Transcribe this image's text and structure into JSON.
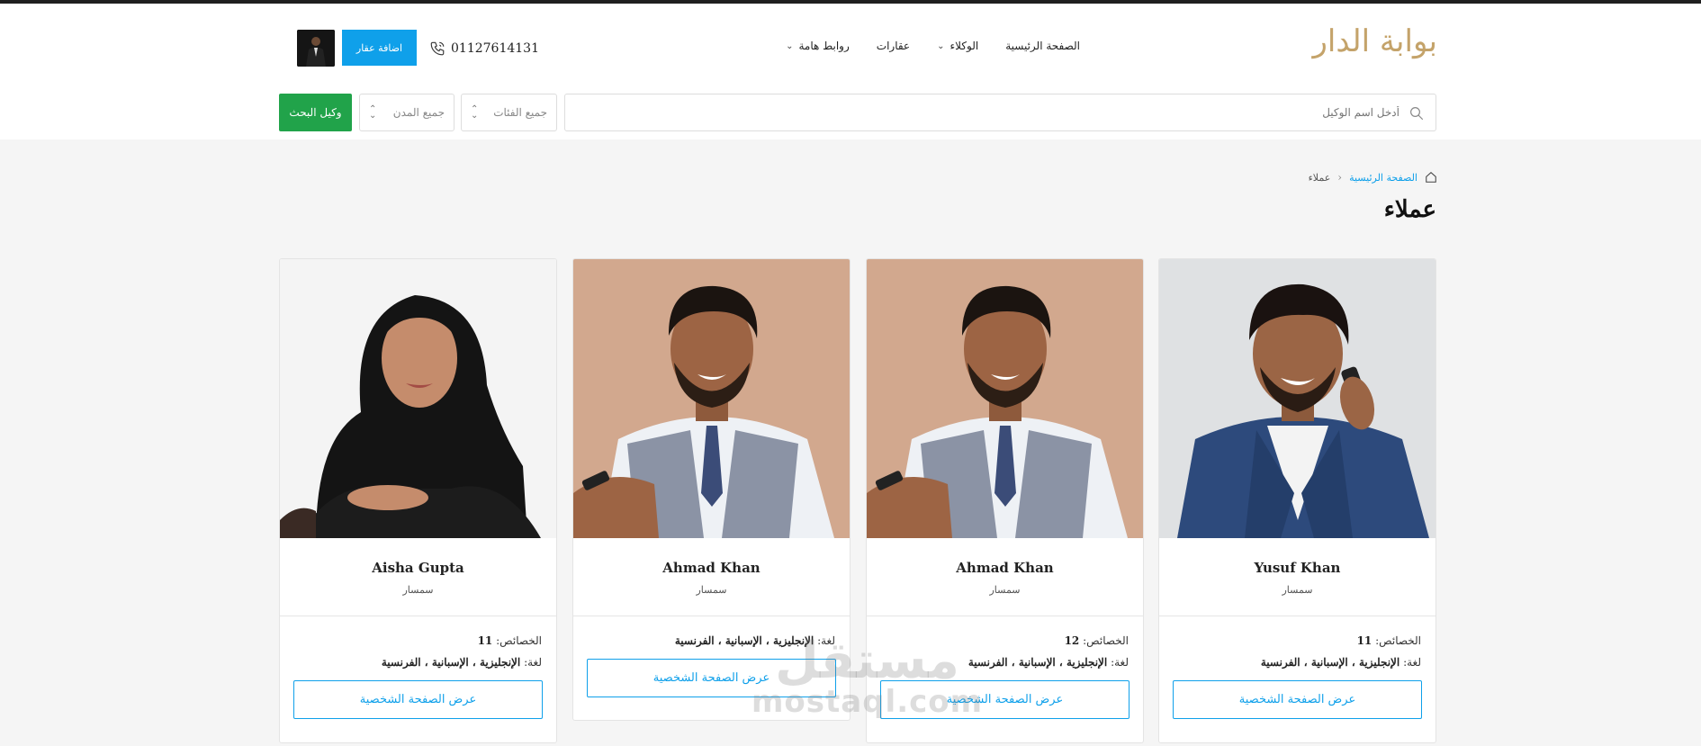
{
  "header": {
    "logo_text": "بوابة الدار",
    "nav": [
      {
        "label": "الصفحة الرئيسية",
        "has_dropdown": false
      },
      {
        "label": "الوكلاء",
        "has_dropdown": true
      },
      {
        "label": "عقارات",
        "has_dropdown": false
      },
      {
        "label": "روابط هامة",
        "has_dropdown": true
      }
    ],
    "phone": "01127614131",
    "add_property_label": "اضافة عقار"
  },
  "search": {
    "placeholder": "أدخل اسم الوكيل",
    "category_select": "جميع الفئات",
    "city_select": "جميع المدن",
    "submit_label": "وكيل البحث"
  },
  "breadcrumb": {
    "home": "الصفحة الرئيسية",
    "current": "عملاء"
  },
  "page_title": "عملاء",
  "agents": [
    {
      "name": "Yusuf Khan",
      "role": "سمسار",
      "properties_label": "الخصائص:",
      "properties": "11",
      "language_label": "لغة:",
      "languages": "الإنجليزية ، الإسبانية ، الفرنسية",
      "button": "عرض الصفحة الشخصية"
    },
    {
      "name": "Ahmad Khan",
      "role": "سمسار",
      "properties_label": "الخصائص:",
      "properties": "12",
      "language_label": "لغة:",
      "languages": "الإنجليزية ، الإسبانية ، الفرنسية",
      "button": "عرض الصفحة الشخصية"
    },
    {
      "name": "Ahmad Khan",
      "role": "سمسار",
      "language_label": "لغة:",
      "languages": "الإنجليزية ، الإسبانية ، الفرنسية",
      "button": "عرض الصفحة الشخصية"
    },
    {
      "name": "Aisha Gupta",
      "role": "سمسار",
      "properties_label": "الخصائص:",
      "properties": "11",
      "language_label": "لغة:",
      "languages": "الإنجليزية ، الإسبانية ، الفرنسية",
      "button": "عرض الصفحة الشخصية"
    }
  ],
  "watermark": {
    "ar": "مستقل",
    "en": "mostaql.com"
  },
  "colors": {
    "accent": "#0fa0ea",
    "search_button": "#21a34a",
    "logo": "#c4a36a"
  },
  "icons": {
    "search": "search-icon",
    "phone": "phone-icon",
    "home": "home-icon",
    "chevron": "chevron-down-icon",
    "sort": "updown-icon"
  }
}
